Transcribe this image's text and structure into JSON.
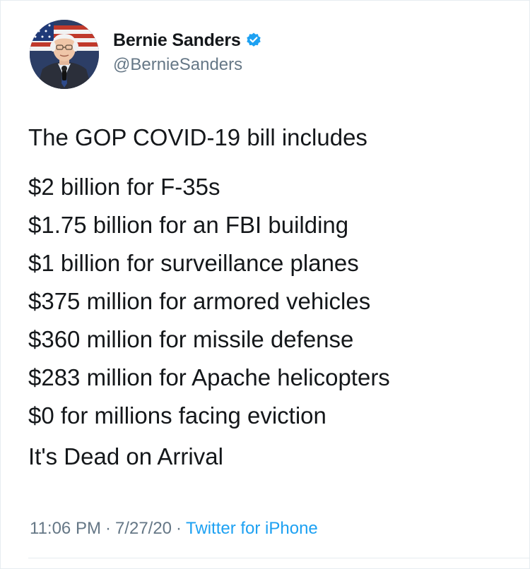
{
  "author": {
    "display_name": "Bernie Sanders",
    "handle": "@BernieSanders",
    "verified": true,
    "verified_icon": "verified-badge-icon"
  },
  "tweet": {
    "intro": "The GOP COVID-19 bill includes",
    "lines": [
      "$2 billion for F-35s",
      "$1.75 billion for an FBI building",
      "$1 billion for surveillance planes",
      "$375 million for armored vehicles",
      "$360 million for missile defense",
      "$283 million for Apache helicopters",
      "$0 for millions facing eviction"
    ],
    "closing": "It's Dead on Arrival"
  },
  "meta": {
    "time": "11:06 PM",
    "date": "7/27/20",
    "separator": "·",
    "source": "Twitter for iPhone"
  },
  "colors": {
    "text": "#14171a",
    "secondary": "#657786",
    "link": "#1da1f2",
    "verified": "#1da1f2",
    "border": "#e6ecf0"
  }
}
